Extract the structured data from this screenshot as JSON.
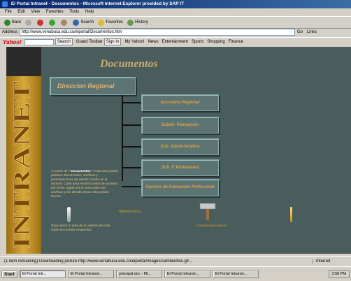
{
  "window": {
    "title": "El Portal Intranet - Documentos - Microsoft Internet Explorer provided by SAP IT"
  },
  "menu": [
    "File",
    "Edit",
    "View",
    "Favorites",
    "Tools",
    "Help"
  ],
  "toolbar": {
    "back": "Back",
    "search": "Search",
    "favorites": "Favorites",
    "history": "History"
  },
  "address": {
    "label": "Address",
    "url": "http://www.venabuca.edu.co/elportal/Documentos.htm",
    "go": "Go",
    "links": "Links"
  },
  "yahoo": {
    "search_btn": "Search",
    "guard": "Guard Toolbar",
    "signin": "Sign In",
    "my_yahoo": "My Yahoo!",
    "news": "News",
    "entertainment": "Entertainment",
    "sports": "Sports",
    "shopping": "Shopping",
    "finance": "Finance",
    "yahoo": "Yahoo!"
  },
  "page": {
    "title": "Documentos",
    "vertical_title": "INTRANET",
    "main_button": "Direccion Regional",
    "sub_buttons": [
      "Secretaría Regional",
      "Subdir. Planeación",
      "Sub. Administrativa",
      "Sub. F. Profesional",
      "Centros de Formación Profesional"
    ],
    "intro_prefix": "A través de",
    "intro_highlight": "\" Documentos \"",
    "intro_body": "cada área podrá publicar documentos, archivos y presentaciones de interés común en la intranet. Cada área tendrá control de archivos por fecha según así el caso sobre los archivos y las demás áreas solo podrán leerlos.",
    "intro2": "Para entrar al área de su interés de click sobre su nombre respectivo.",
    "biblio_label": "Bibliotecalcoa",
    "hammer_label": "Consultar Base Banco"
  },
  "status": {
    "message": "(1 item remaining) Downloading picture http://www.venabuca.edu.co/elportal/images/cambiodtos.gif...",
    "zone": "Internet"
  },
  "taskbar": {
    "start": "Start",
    "tasks": [
      "El Portal Intr...",
      "El Portal Intranet...",
      "principal.doc - Mi...",
      "El Portal Intranet...",
      "El Portal Intranet..."
    ],
    "clock": "3:58 PM"
  },
  "colors": {
    "background": "#4a5d5d",
    "button_face": "#5c7474",
    "gold": "#c9a96e",
    "label_orange": "#e0a040"
  }
}
